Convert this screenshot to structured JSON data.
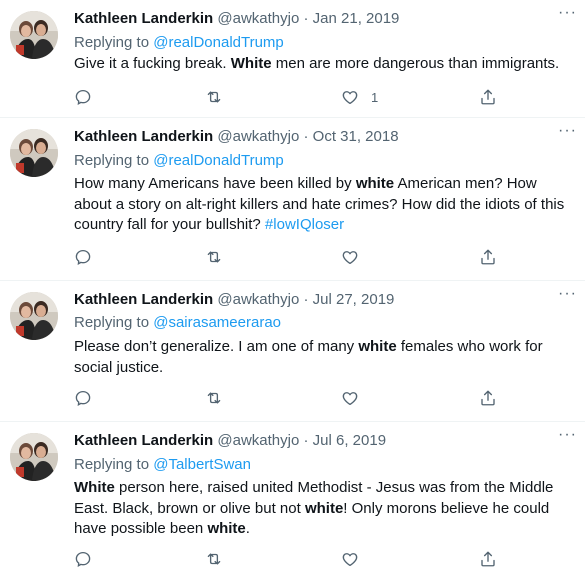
{
  "tweets": [
    {
      "name": "Kathleen Landerkin",
      "handle": "@awkathyjo",
      "date": "Jan 21, 2019",
      "replying_prefix": "Replying to ",
      "replying_to": "@realDonaldTrump",
      "text": [
        {
          "t": "Give it a fucking break. "
        },
        {
          "t": "White",
          "b": true
        },
        {
          "t": " men are more dangerous than immigrants."
        }
      ],
      "likes": "1"
    },
    {
      "name": "Kathleen Landerkin",
      "handle": "@awkathyjo",
      "date": "Oct 31, 2018",
      "replying_prefix": "Replying to ",
      "replying_to": "@realDonaldTrump",
      "text": [
        {
          "t": "How many Americans have been killed by "
        },
        {
          "t": "white",
          "b": true
        },
        {
          "t": " American men?  How about a story on alt-right killers and hate crimes?  How did the idiots of this country fall for your bullshit? "
        },
        {
          "t": "#lowIQloser",
          "l": true
        }
      ],
      "likes": ""
    },
    {
      "name": "Kathleen Landerkin",
      "handle": "@awkathyjo",
      "date": "Jul 27, 2019",
      "replying_prefix": "Replying to ",
      "replying_to": "@sairasameerarao",
      "text": [
        {
          "t": "Please don’t generalize. I am one of many "
        },
        {
          "t": "white",
          "b": true
        },
        {
          "t": " females who work for social justice."
        }
      ],
      "likes": ""
    },
    {
      "name": "Kathleen Landerkin",
      "handle": "@awkathyjo",
      "date": "Jul 6, 2019",
      "replying_prefix": "Replying to ",
      "replying_to": "@TalbertSwan",
      "text": [
        {
          "t": "White",
          "b": true
        },
        {
          "t": " person here, raised united Methodist - Jesus was from the Middle East. Black, brown or olive but not "
        },
        {
          "t": "white",
          "b": true
        },
        {
          "t": "! Only morons believe he could have possible been "
        },
        {
          "t": "white",
          "b": true
        },
        {
          "t": "."
        }
      ],
      "likes": ""
    }
  ],
  "separator": " · ",
  "more_glyph": "···",
  "icons": [
    "reply-icon",
    "retweet-icon",
    "like-icon",
    "share-icon"
  ],
  "colors": {
    "link": "#1d9bf0",
    "secondary": "#536471",
    "text": "#0f1419"
  }
}
